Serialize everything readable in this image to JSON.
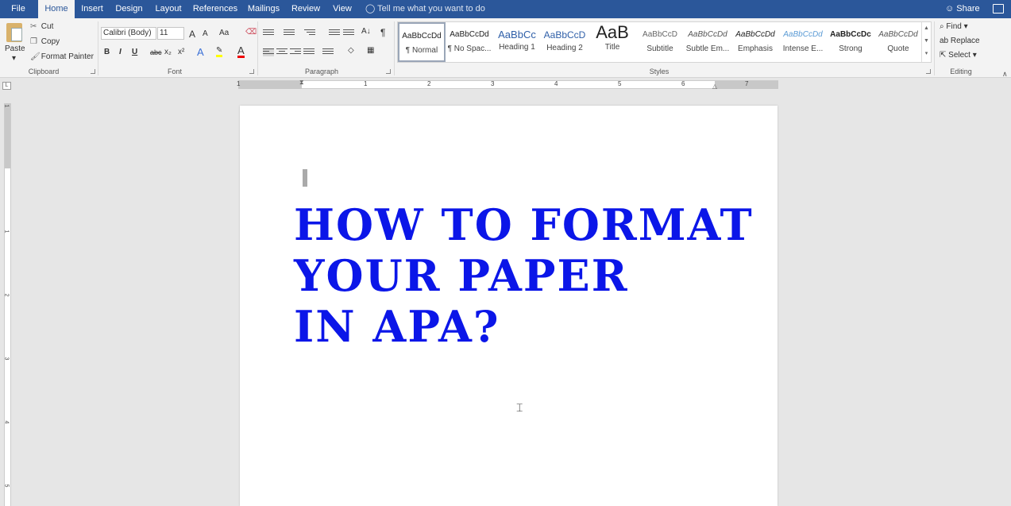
{
  "tabs": [
    "File",
    "Home",
    "Insert",
    "Design",
    "Layout",
    "References",
    "Mailings",
    "Review",
    "View"
  ],
  "active_tab": "Home",
  "tell_me": "Tell me what you want to do",
  "share": "Share",
  "clipboard": {
    "paste": "Paste",
    "cut": "Cut",
    "copy": "Copy",
    "format_painter": "Format Painter",
    "label": "Clipboard"
  },
  "font": {
    "name": "Calibri (Body)",
    "size": "11",
    "label": "Font",
    "bold": "B",
    "italic": "I",
    "underline": "U",
    "strike": "abc",
    "subscript": "x₂",
    "superscript": "x²",
    "grow": "A",
    "shrink": "A",
    "case": "Aa"
  },
  "paragraph": {
    "label": "Paragraph"
  },
  "styles": {
    "label": "Styles",
    "items": [
      {
        "sample": "AaBbCcDd",
        "name": "¶ Normal"
      },
      {
        "sample": "AaBbCcDd",
        "name": "¶ No Spac..."
      },
      {
        "sample": "AaBbCc",
        "name": "Heading 1"
      },
      {
        "sample": "AaBbCcD",
        "name": "Heading 2"
      },
      {
        "sample": "AaB",
        "name": "Title"
      },
      {
        "sample": "AaBbCcD",
        "name": "Subtitle"
      },
      {
        "sample": "AaBbCcDd",
        "name": "Subtle Em..."
      },
      {
        "sample": "AaBbCcDd",
        "name": "Emphasis"
      },
      {
        "sample": "AaBbCcDd",
        "name": "Intense E..."
      },
      {
        "sample": "AaBbCcDc",
        "name": "Strong"
      },
      {
        "sample": "AaBbCcDd",
        "name": "Quote"
      }
    ]
  },
  "editing": {
    "label": "Editing",
    "find": "Find",
    "replace": "Replace",
    "select": "Select"
  },
  "ruler": {
    "h_numbers": [
      "1",
      "1",
      "2",
      "3",
      "4",
      "5",
      "6",
      "7"
    ],
    "v_numbers": [
      "1",
      "1",
      "2",
      "3",
      "4",
      "5"
    ],
    "corner": "L"
  },
  "document": {
    "title_lines": [
      "How to format",
      "your paper",
      "in APA?"
    ],
    "title_color": "#0b16e8"
  },
  "colors": {
    "accent": "#2b579a"
  }
}
